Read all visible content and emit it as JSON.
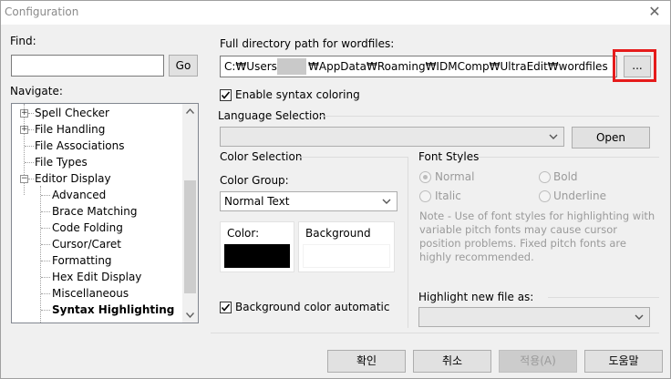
{
  "window": {
    "title": "Configuration"
  },
  "find": {
    "label": "Find:",
    "value": "",
    "go_label": "Go"
  },
  "navigate": {
    "label": "Navigate:",
    "items": [
      {
        "label": "Spell Checker",
        "level": 0,
        "expander": "+"
      },
      {
        "label": "File Handling",
        "level": 0,
        "expander": "+"
      },
      {
        "label": "File Associations",
        "level": 0,
        "expander": ""
      },
      {
        "label": "File Types",
        "level": 0,
        "expander": ""
      },
      {
        "label": "Editor Display",
        "level": 0,
        "expander": "-"
      },
      {
        "label": "Advanced",
        "level": 1
      },
      {
        "label": "Brace Matching",
        "level": 1
      },
      {
        "label": "Code Folding",
        "level": 1
      },
      {
        "label": "Cursor/Caret",
        "level": 1
      },
      {
        "label": "Formatting",
        "level": 1
      },
      {
        "label": "Hex Edit Display",
        "level": 1
      },
      {
        "label": "Miscellaneous",
        "level": 1
      },
      {
        "label": "Syntax Highlighting",
        "level": 1,
        "selected": true
      }
    ]
  },
  "wordfiles": {
    "label": "Full directory path for wordfiles:",
    "path_prefix": "C:₩Users₩",
    "path_suffix": "₩AppData₩Roaming₩IDMComp₩UltraEdit₩wordfiles",
    "browse_label": "...",
    "browse_highlight_color": "#e51b1b"
  },
  "syntax": {
    "enable_label": "Enable syntax coloring",
    "enabled": true
  },
  "language": {
    "section_label": "Language Selection",
    "value": "",
    "open_label": "Open"
  },
  "color_selection": {
    "section_label": "Color Selection",
    "group_label": "Color Group:",
    "group_value": "Normal Text",
    "color_label": "Color:",
    "color_value": "#000000",
    "background_label": "Background",
    "background_value": "#ffffff",
    "bg_auto_label": "Background color automatic",
    "bg_auto_checked": true
  },
  "font_styles": {
    "section_label": "Font Styles",
    "options": [
      {
        "label": "Normal",
        "selected": true
      },
      {
        "label": "Bold",
        "selected": false
      },
      {
        "label": "Italic",
        "selected": false
      },
      {
        "label": "Underline",
        "selected": false
      }
    ],
    "note": "Note - Use of font styles for highlighting with variable pitch fonts may cause cursor position problems.  Fixed pitch fonts are highly recommended."
  },
  "highlight_new": {
    "label": "Highlight new file as:",
    "value": ""
  },
  "buttons": {
    "ok": "확인",
    "cancel": "취소",
    "apply": "적용(A)",
    "help": "도움말"
  }
}
